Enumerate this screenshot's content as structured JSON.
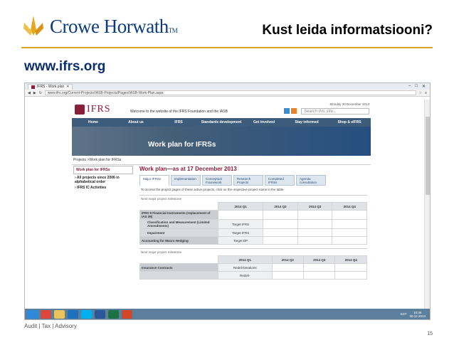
{
  "header": {
    "logo_text": "Crowe Horwath",
    "logo_tm": "TM",
    "title": "Kust leida informatsiooni?",
    "url": "www.ifrs.org"
  },
  "colors": {
    "brand_blue": "#0b3c7d",
    "gold": "#e0a41f",
    "ifrs_red": "#8a1f3a",
    "nav_blue": "#3d5b7a"
  },
  "browser": {
    "tab_label": "IFRS - Work plan",
    "address": "www.ifrs.org/Current-Projects/IASB-Projects/Pages/IASB-Work-Plan.aspx",
    "controls": [
      "–",
      "□",
      "✕"
    ]
  },
  "ifrs_page": {
    "logo": "IFRS",
    "welcome": "Welcome to the website of the IFRS Foundation and the IASB",
    "date": "Monday 30 December 2013",
    "search_placeholder": "Search this site...",
    "nav": [
      "Home",
      "About us",
      "IFRS",
      "Standards development",
      "Get involved",
      "Stay informed",
      "Shop & eIFRS"
    ],
    "banner_title": "Work plan for IFRSs",
    "breadcrumb": "Projects >Work plan for IFRSs",
    "left_nav": {
      "active": "Work plan for IFRSs",
      "items": [
        "All projects since 2006 in alphabetical order",
        "IFRS IC Activities"
      ]
    },
    "content": {
      "title": "Work plan—as at 17 December 2013",
      "tabs": [
        "Major IFRSs",
        "Implementation",
        "Conceptual Framework",
        "Research Projects",
        "Completed IFRSs",
        "Agenda consultation"
      ],
      "intro": "To access the project pages of these active projects, click on the respective project name in the table.",
      "section1": "Next major project milestone",
      "quarters": [
        "2014 Q1",
        "2014 Q2",
        "2014 Q3",
        "2014 Q4"
      ],
      "rows1": [
        {
          "name": "IFRS 9 Financial Instruments (replacement of IAS 39)",
          "q": [
            "",
            "",
            "",
            ""
          ],
          "kind": "prj"
        },
        {
          "name": "Classification and Measurement (Limited Amendments)",
          "q": [
            "Target IFRS",
            "",
            "",
            ""
          ],
          "kind": "sub"
        },
        {
          "name": "Impairment",
          "q": [
            "Target IFRS",
            "",
            "",
            ""
          ],
          "kind": "sub"
        },
        {
          "name": "Accounting for Macro Hedging",
          "q": [
            "Target DP",
            "",
            "",
            ""
          ],
          "kind": "prj"
        }
      ],
      "section2": "Next major project milestone",
      "rows2": [
        {
          "name": "Insurance Contracts",
          "q": [
            "Redeli-berations",
            "",
            "",
            ""
          ],
          "kind": "prj"
        },
        {
          "name": "",
          "q": [
            "Redeli-",
            "",
            "",
            ""
          ],
          "kind": "sub"
        }
      ]
    }
  },
  "taskbar": {
    "time": "15:36",
    "date": "30.12.2013",
    "lang": "EST"
  },
  "footer": {
    "text": "Audit | Tax | Advisory",
    "page": "15"
  }
}
